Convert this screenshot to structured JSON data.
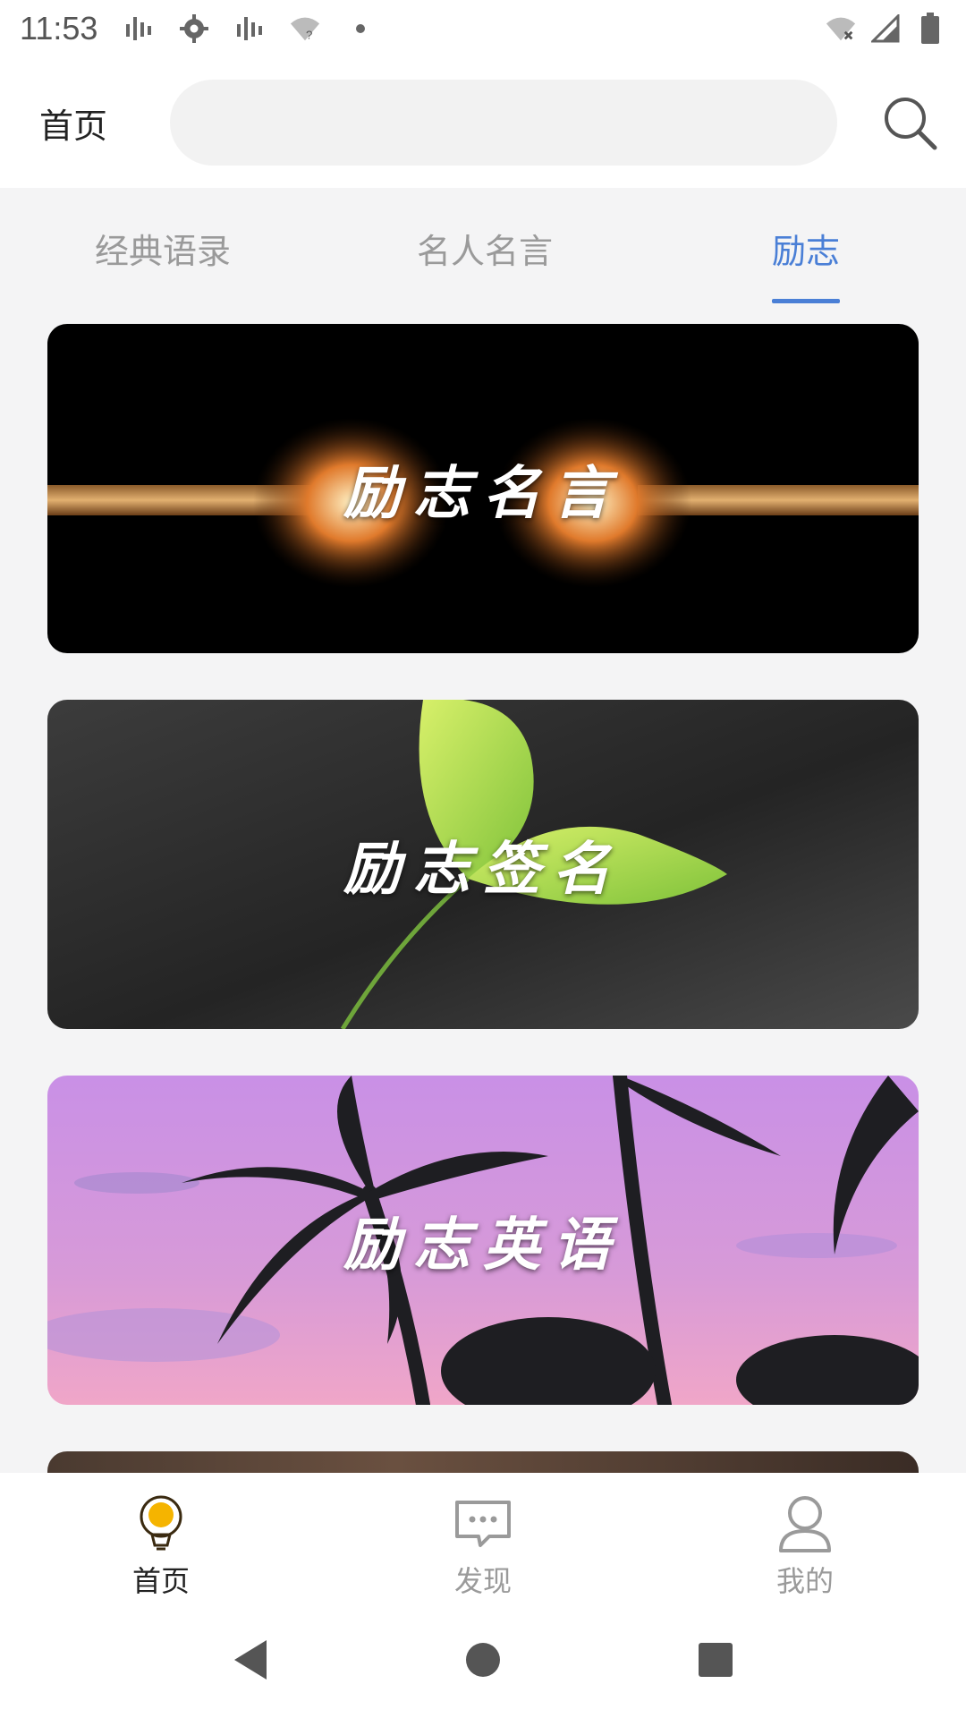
{
  "status_bar": {
    "time": "11:53",
    "icons_left": [
      "signal-bars-icon",
      "gear-icon",
      "signal-bars-icon",
      "wifi-question-icon",
      "dot-icon"
    ],
    "icons_right": [
      "wifi-off-icon",
      "cell-signal-icon",
      "battery-icon"
    ]
  },
  "header": {
    "title": "首页",
    "search_value": "",
    "search_icon": "search-icon"
  },
  "tabs": [
    {
      "label": "经典语录",
      "active": false
    },
    {
      "label": "名人名言",
      "active": false
    },
    {
      "label": "励志",
      "active": true
    }
  ],
  "cards": [
    {
      "title": "励志名言",
      "image": "broken-rope"
    },
    {
      "title": "励志签名",
      "image": "green-leaves"
    },
    {
      "title": "励志英语",
      "image": "palm-trees-sunset"
    }
  ],
  "bottom_nav": [
    {
      "label": "首页",
      "icon": "lightbulb-icon",
      "active": true
    },
    {
      "label": "发现",
      "icon": "chat-bubble-icon",
      "active": false
    },
    {
      "label": "我的",
      "icon": "user-icon",
      "active": false
    }
  ],
  "system_nav": [
    "back-triangle-icon",
    "home-circle-icon",
    "recents-square-icon"
  ],
  "colors": {
    "accent": "#4a7fd6",
    "inactive_text": "#9a9a9a",
    "active_nav_icon": "#f5b400"
  }
}
